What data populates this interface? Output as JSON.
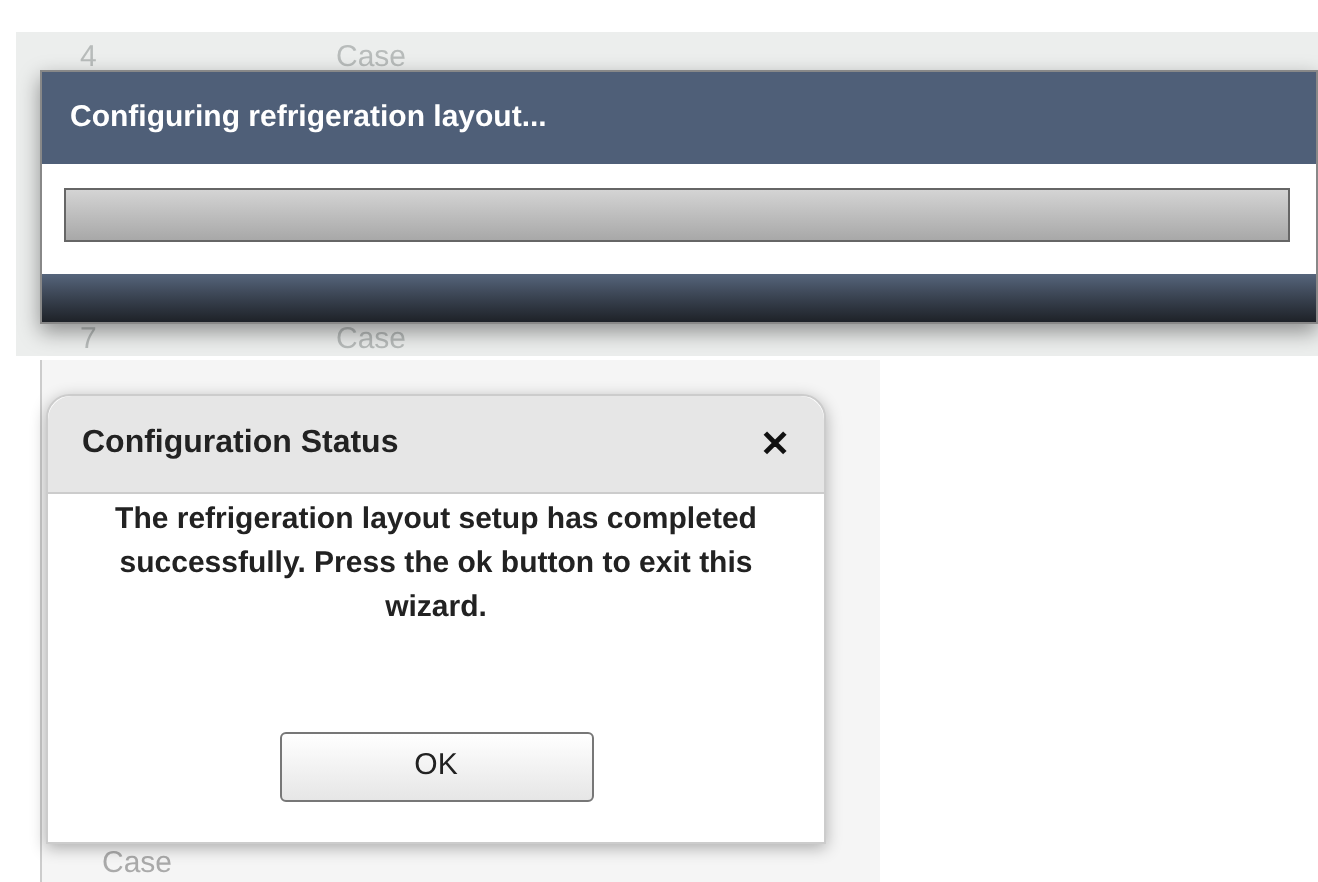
{
  "background_top": {
    "rows": [
      {
        "number": "4",
        "type": "Case"
      },
      {
        "number": "7",
        "type": "Case"
      }
    ]
  },
  "progress_dialog": {
    "title": "Configuring refrigeration layout...",
    "progress": {
      "level": 1
    }
  },
  "background_bottom": {
    "rows": [
      {
        "type": "Case"
      }
    ]
  },
  "status_dialog": {
    "title": "Configuration Status",
    "close": "✕",
    "message": "The refrigeration layout setup has completed successfully. Press the ok button to exit this wizard.",
    "buttons": [
      "OK"
    ]
  }
}
